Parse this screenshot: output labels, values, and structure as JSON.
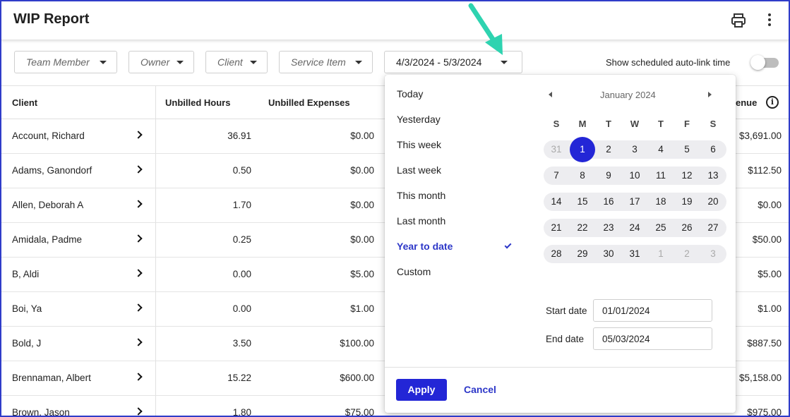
{
  "header": {
    "title": "WIP Report"
  },
  "filters": {
    "team_member": "Team Member",
    "owner": "Owner",
    "client": "Client",
    "service_item": "Service Item",
    "date_range": "4/3/2024 - 5/3/2024",
    "autolink_label": "Show scheduled auto-link time"
  },
  "table": {
    "headers": {
      "client": "Client",
      "unbilled_hours": "Unbilled Hours",
      "unbilled_expenses": "Unbilled Expenses",
      "revenue": "enue"
    },
    "rows": [
      {
        "client": "Account, Richard",
        "hours": "36.91",
        "expenses": "$0.00",
        "revenue": "$3,691.00"
      },
      {
        "client": "Adams, Ganondorf",
        "hours": "0.50",
        "expenses": "$0.00",
        "revenue": "$112.50"
      },
      {
        "client": "Allen, Deborah A",
        "hours": "1.70",
        "expenses": "$0.00",
        "revenue": "$0.00"
      },
      {
        "client": "Amidala, Padme",
        "hours": "0.25",
        "expenses": "$0.00",
        "revenue": "$50.00"
      },
      {
        "client": "B, Aldi",
        "hours": "0.00",
        "expenses": "$5.00",
        "revenue": "$5.00"
      },
      {
        "client": "Boi, Ya",
        "hours": "0.00",
        "expenses": "$1.00",
        "revenue": "$1.00"
      },
      {
        "client": "Bold, J",
        "hours": "3.50",
        "expenses": "$100.00",
        "revenue": "$887.50"
      },
      {
        "client": "Brennaman, Albert",
        "hours": "15.22",
        "expenses": "$600.00",
        "revenue": "$5,158.00"
      },
      {
        "client": "Brown, Jason",
        "hours": "1.80",
        "expenses": "$75.00",
        "revenue": "$975.00"
      }
    ]
  },
  "popup": {
    "presets": [
      "Today",
      "Yesterday",
      "This week",
      "Last week",
      "This month",
      "Last month",
      "Year to date",
      "Custom"
    ],
    "active_preset": "Year to date",
    "calendar": {
      "month_label": "January 2024",
      "weekdays": [
        "S",
        "M",
        "T",
        "W",
        "T",
        "F",
        "S"
      ],
      "weeks": [
        [
          "31",
          "1",
          "2",
          "3",
          "4",
          "5",
          "6"
        ],
        [
          "7",
          "8",
          "9",
          "10",
          "11",
          "12",
          "13"
        ],
        [
          "14",
          "15",
          "16",
          "17",
          "18",
          "19",
          "20"
        ],
        [
          "21",
          "22",
          "23",
          "24",
          "25",
          "26",
          "27"
        ],
        [
          "28",
          "29",
          "30",
          "31",
          "1",
          "2",
          "3"
        ]
      ],
      "selected_day": "1"
    },
    "start_label": "Start date",
    "start_value": "01/01/2024",
    "end_label": "End date",
    "end_value": "05/03/2024",
    "apply_label": "Apply",
    "cancel_label": "Cancel"
  },
  "colors": {
    "accent": "#2326d6",
    "annotation_arrow": "#2ed3b0"
  }
}
